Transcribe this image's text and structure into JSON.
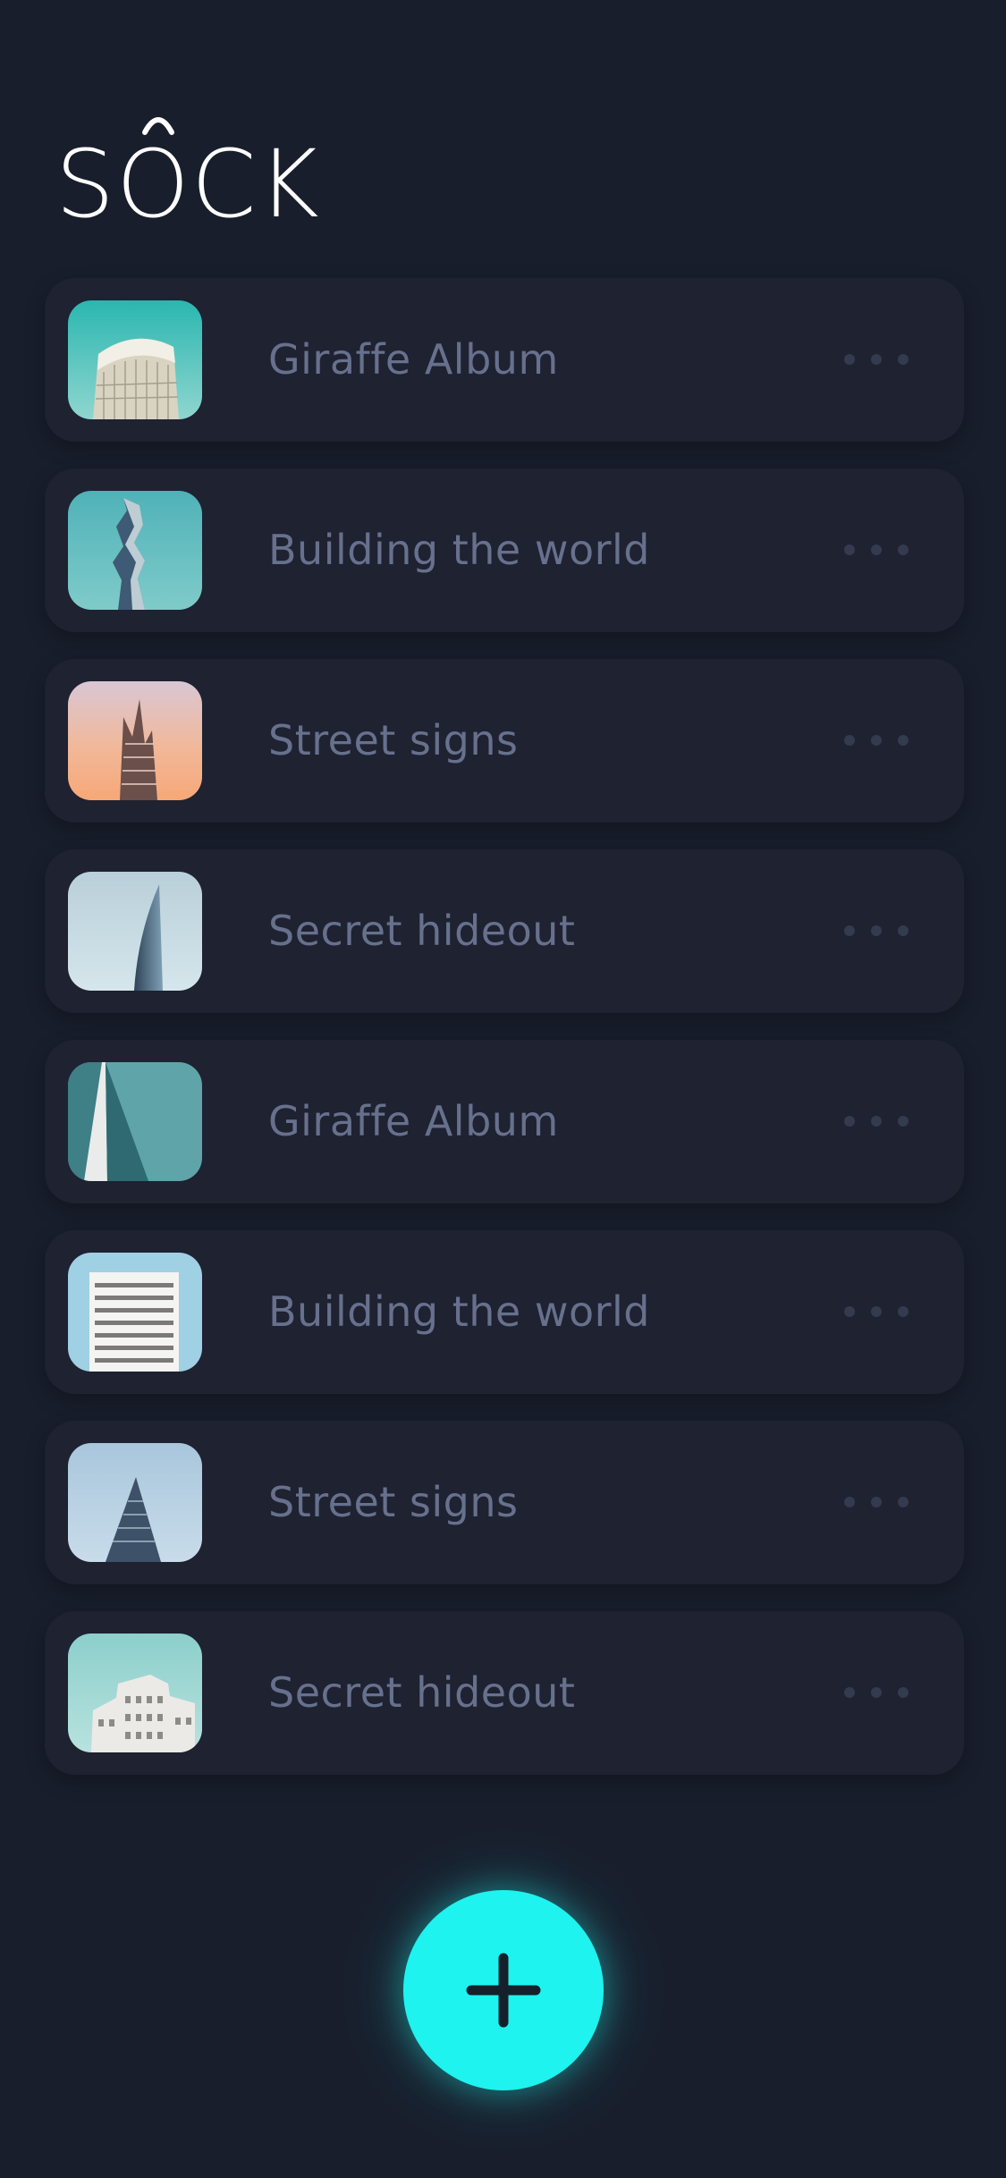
{
  "app": {
    "title": "SOCK"
  },
  "albums": [
    {
      "title": "Giraffe Album",
      "thumbnail": "curved-glass-tower"
    },
    {
      "title": "Building the world",
      "thumbnail": "twisted-tower"
    },
    {
      "title": "Street signs",
      "thumbnail": "spiked-skyscraper-peach-sky"
    },
    {
      "title": "Secret hideout",
      "thumbnail": "blade-skyscraper"
    },
    {
      "title": "Giraffe Album",
      "thumbnail": "triangular-facade"
    },
    {
      "title": "Building the world",
      "thumbnail": "white-apartment-block"
    },
    {
      "title": "Street signs",
      "thumbnail": "pyramid-tower"
    },
    {
      "title": "Secret hideout",
      "thumbnail": "white-building-cluster"
    }
  ],
  "actions": {
    "add_icon": "plus-icon",
    "more_icon": "more-horizontal-icon"
  },
  "colors": {
    "background": "#191e2c",
    "card": "#1e2231",
    "text": "#67708c",
    "accent": "#1ef3ef",
    "logo": "#ffffff"
  }
}
